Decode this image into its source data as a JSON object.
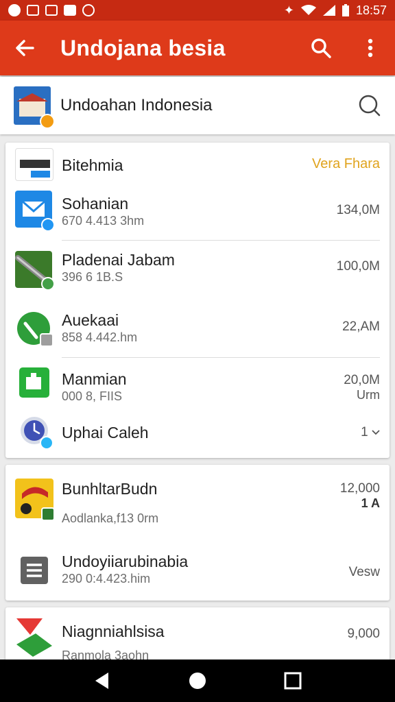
{
  "status_bar": {
    "time": "18:57",
    "icons": [
      "notification-icon",
      "sim-icon",
      "image-icon",
      "mail-icon",
      "record-icon",
      "vibrate-icon",
      "wifi-icon",
      "signal-icon",
      "battery-icon"
    ]
  },
  "app_bar": {
    "title": "Undojana besia",
    "back_icon": "arrow-back-icon",
    "search_icon": "search-icon",
    "menu_icon": "more-vert-icon"
  },
  "header_card": {
    "title": "Undoahan Indonesia",
    "icon": "house-app-icon",
    "search_icon": "search-icon"
  },
  "section1": {
    "title": "Bitehmia",
    "action": "Vera Fhara",
    "items": [
      {
        "name": "Sohanian",
        "sub": "670 4.413 3hm",
        "value": "134,0M",
        "icon_color": "#1e88e5",
        "badge_color": "#2196f3"
      },
      {
        "name": "Pladenai Jabam",
        "sub": "396 6 1B.S",
        "value": "100,0M",
        "icon_color": "#3b7a2a",
        "badge_color": "#43a047"
      },
      {
        "name": "Auekaai",
        "sub": "858 4.442.hm",
        "value": "22,AM",
        "icon_color": "#2e9e3a",
        "badge_color": "#9e9e9e"
      },
      {
        "name": "Manmian",
        "sub": "000 8, FIIS",
        "value": "20,0M",
        "value2": "Urm",
        "icon_color": "#27b03a",
        "badge_color": ""
      },
      {
        "name": "Uphai Caleh",
        "sub": "",
        "value": "1",
        "icon_color": "#3f51b5",
        "badge_color": "#29b6f6"
      }
    ]
  },
  "section2": {
    "items": [
      {
        "name": "BunhltarBudn",
        "sub": "Aodlanka,f13 0rm",
        "value": "12,000",
        "value2": "1 A",
        "icon_color": "#f2c21b",
        "badge_color": "#2e7d32"
      },
      {
        "name": "Undoyiiarubinabia",
        "sub": "290 0:4.423.him",
        "value": "Vesw",
        "icon_color": "#616161",
        "badge_color": ""
      }
    ]
  },
  "section3": {
    "items": [
      {
        "name": "Niagnniahlsisa",
        "sub": "Ranmola 3aohn",
        "value": "9,000",
        "icon_color": "#e53935",
        "badge_color": ""
      }
    ]
  },
  "nav_bar": {
    "icons": [
      "back-triangle-icon",
      "home-circle-icon",
      "recents-square-icon"
    ]
  }
}
